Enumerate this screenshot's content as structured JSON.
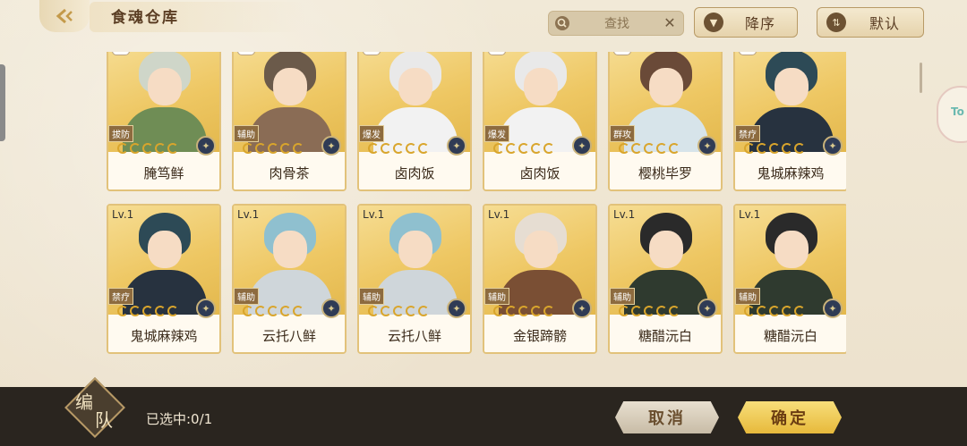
{
  "header": {
    "title": "食魂仓库",
    "search_placeholder": "查找",
    "sort_order_label": "降序",
    "sort_mode_label": "默认"
  },
  "cards": [
    {
      "level": "",
      "role": "拔防",
      "name": "腌笃鲜",
      "hair": "#cfd6c9",
      "outfit": "#6f8d55",
      "stars": 5
    },
    {
      "level": "",
      "role": "辅助",
      "name": "肉骨茶",
      "hair": "#6b5a4a",
      "outfit": "#8a6c55",
      "stars": 5
    },
    {
      "level": "",
      "role": "爆发",
      "name": "卤肉饭",
      "hair": "#e9e9e9",
      "outfit": "#f2f2f2",
      "stars": 5
    },
    {
      "level": "",
      "role": "爆发",
      "name": "卤肉饭",
      "hair": "#e9e9e9",
      "outfit": "#f2f2f2",
      "stars": 5
    },
    {
      "level": "",
      "role": "群攻",
      "name": "樱桃毕罗",
      "hair": "#6a4a38",
      "outfit": "#d7e4ea",
      "stars": 5
    },
    {
      "level": "",
      "role": "禁疗",
      "name": "鬼城麻辣鸡",
      "hair": "#2d4a56",
      "outfit": "#27323f",
      "stars": 5
    },
    {
      "level": "Lv.1",
      "role": "禁疗",
      "name": "鬼城麻辣鸡",
      "hair": "#2d4a56",
      "outfit": "#27323f",
      "stars": 5
    },
    {
      "level": "Lv.1",
      "role": "辅助",
      "name": "云托八鲜",
      "hair": "#8fc0cf",
      "outfit": "#cfd6da",
      "stars": 5
    },
    {
      "level": "Lv.1",
      "role": "辅助",
      "name": "云托八鲜",
      "hair": "#8fc0cf",
      "outfit": "#cfd6da",
      "stars": 5
    },
    {
      "level": "Lv.1",
      "role": "辅助",
      "name": "金银蹄髈",
      "hair": "#e6ddd2",
      "outfit": "#7a4f34",
      "stars": 5
    },
    {
      "level": "Lv.1",
      "role": "辅助",
      "name": "糖醋沅白",
      "hair": "#2a2a2a",
      "outfit": "#2f3a2f",
      "stars": 5
    },
    {
      "level": "Lv.1",
      "role": "辅助",
      "name": "糖醋沅白",
      "hair": "#2a2a2a",
      "outfit": "#2f3a2f",
      "stars": 5
    }
  ],
  "footer": {
    "team_label_1": "编",
    "team_label_2": "队",
    "selected_text": "已选中:0/1",
    "cancel_label": "取消",
    "confirm_label": "确定"
  },
  "side": {
    "float_label": "To"
  }
}
